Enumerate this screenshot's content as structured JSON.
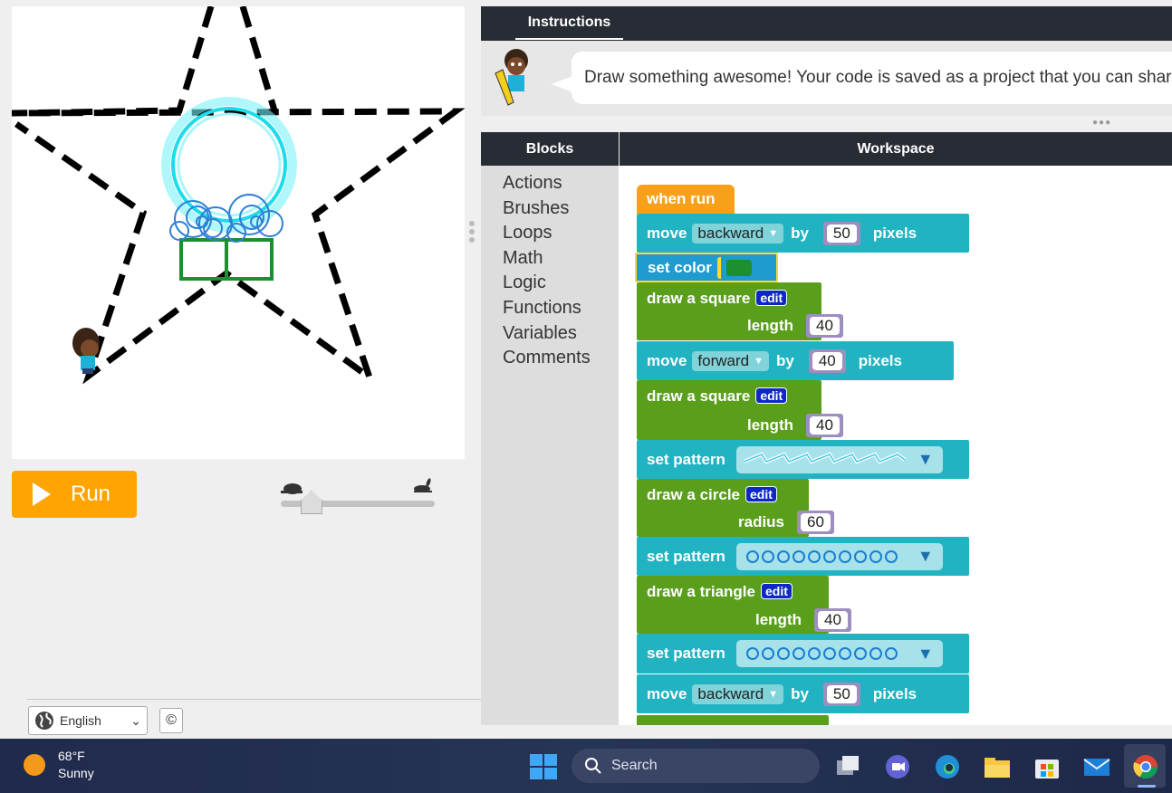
{
  "run_button": {
    "label": "Run"
  },
  "speed": {
    "value": 0.15
  },
  "footer": {
    "language": "English",
    "copyright": "©"
  },
  "instructions": {
    "tab": "Instructions",
    "text": "Draw something awesome! Your code is saved as a project that you can share."
  },
  "blocks_header": "Blocks",
  "workspace_header": "Workspace",
  "categories": [
    "Actions",
    "Brushes",
    "Loops",
    "Math",
    "Logic",
    "Functions",
    "Variables",
    "Comments"
  ],
  "program": {
    "when_run": "when run",
    "move": "move",
    "by": "by",
    "pixels": "pixels",
    "backward": "backward",
    "forward": "forward",
    "set_color": "set color",
    "draw_square": "draw a square",
    "draw_circle": "draw a circle",
    "draw_triangle": "draw a triangle",
    "length": "length",
    "radius": "radius",
    "set_pattern": "set pattern",
    "edit": "edit",
    "v50": "50",
    "v40": "40",
    "v60": "60",
    "color_value": "#1e8f2e"
  },
  "taskbar": {
    "temp": "68°F",
    "condition": "Sunny",
    "search": "Search"
  },
  "colors": {
    "teal": "#21b3c2",
    "green": "#5a9f1c",
    "orange": "#f7a11b",
    "run": "#ffa400",
    "dark_header": "#282c34"
  }
}
